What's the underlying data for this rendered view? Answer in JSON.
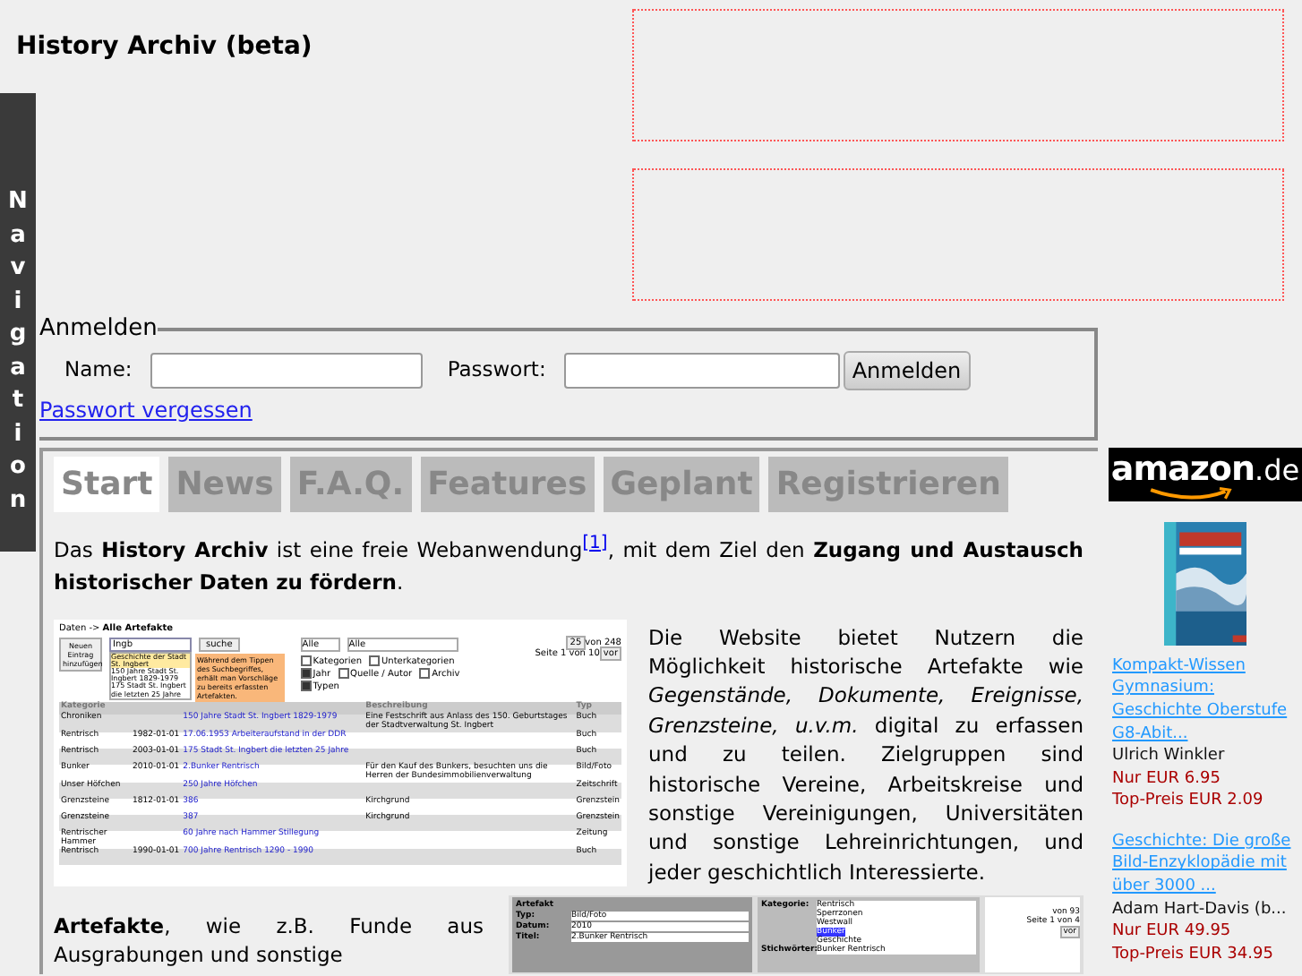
{
  "site_title": "History Archiv (beta)",
  "navigation": {
    "label": "Navigation"
  },
  "login": {
    "legend": "Anmelden",
    "name_label": "Name:",
    "password_label": "Passwort:",
    "submit": "Anmelden",
    "forgot_link": "Passwort vergessen"
  },
  "tabs": [
    {
      "label": "Start",
      "selected": true
    },
    {
      "label": "News",
      "selected": false
    },
    {
      "label": "F.A.Q.",
      "selected": false
    },
    {
      "label": "Features",
      "selected": false
    },
    {
      "label": "Geplant",
      "selected": false
    },
    {
      "label": "Registrieren",
      "selected": false
    }
  ],
  "intro": "Das **History Archiv** ist eine freie Webanwendung$^{[1]}$, mit dem Ziel den **Zugang und Austausch historischer Daten zu fördern**.",
  "description": "Die Website bietet Nutzern die Möglichkeit historische Artefakte wie *Gegenstände, Dokumente, Ereignisse, Grenzsteine, u.v.m.* digital zu erfassen und zu teilen. Zielgruppen sind historische Vereine, Arbeitskreise und sonstige Vereinigungen, Universitäten und sonstige Lehreinrichtungen, und jeder geschichtlich Interessierte.",
  "artefakte": "**Artefakte**, wie z.B. Funde aus Ausgrabungen und sonstige",
  "screenshot_list": {
    "breadcrumb": "Daten -> **Alle Artefakte**",
    "new_button": "Neuen Eintrag hinzufügen",
    "search_value": "Ingb",
    "search_button": "suche",
    "select_1": "Alle",
    "select_2": "Alle",
    "per_page": "25",
    "count": "von 248",
    "page": "Seite 1 von 10",
    "next": "vor",
    "filters": [
      {
        "label": "Kategorien",
        "checked": false
      },
      {
        "label": "Unterkategorien",
        "checked": false
      },
      {
        "label": "Jahr",
        "checked": true
      },
      {
        "label": "Quelle / Autor",
        "checked": false
      },
      {
        "label": "Archiv",
        "checked": false
      },
      {
        "label": "Typen",
        "checked": true
      }
    ],
    "suggestions": [
      {
        "text": "Geschichte der Stadt St. Ingbert",
        "selected": true
      },
      {
        "text": "150 Jahre Stadt St. Ingbert 1829-1979",
        "selected": false
      },
      {
        "text": "175 Stadt St. Ingbert die letzten 25 Jahre",
        "selected": false
      }
    ],
    "tooltip": "Während dem Tippen des Suchbegriffes, erhält man Vorschläge zu bereits erfassten Artefakten.",
    "columns": [
      "Kategorie",
      "Beschreibung",
      "Typ"
    ],
    "rows": [
      {
        "category": "Chroniken",
        "date": "",
        "title": "150 Jahre Stadt St. Ingbert 1829-1979",
        "description": "Eine Festschrift aus Anlass des 150. Geburtstages der Stadtverwaltung St. Ingbert",
        "type": "Buch"
      },
      {
        "category": "Rentrisch",
        "date": "1982-01-01",
        "title": "17.06.1953 Arbeiteraufstand in der DDR",
        "description": "",
        "type": "Buch"
      },
      {
        "category": "Rentrisch",
        "date": "2003-01-01",
        "title": "175 Stadt St. Ingbert die letzten 25 Jahre",
        "description": "",
        "type": "Buch"
      },
      {
        "category": "Bunker",
        "date": "2010-01-01",
        "title": "2.Bunker Rentrisch",
        "description": "Für den Kauf des Bunkers, besuchten uns die Herren der Bundesimmobilienverwaltung",
        "type": "Bild/Foto"
      },
      {
        "category": "Unser Höfchen",
        "date": "",
        "title": "250 Jahre Höfchen",
        "description": "",
        "type": "Zeitschrift"
      },
      {
        "category": "Grenzsteine",
        "date": "1812-01-01",
        "title": "386",
        "description": "Kirchgrund",
        "type": "Grenzstein"
      },
      {
        "category": "Grenzsteine",
        "date": "",
        "title": "387",
        "description": "Kirchgrund",
        "type": "Grenzstein"
      },
      {
        "category": "Rentrischer Hammer",
        "date": "",
        "title": "60 Jahre nach Hammer Stillegung",
        "description": "",
        "type": "Zeitung"
      },
      {
        "category": "Rentrisch",
        "date": "1990-01-01",
        "title": "700 Jahre Rentrisch 1290 - 1990",
        "description": "",
        "type": "Buch"
      }
    ]
  },
  "screenshot_edit": {
    "section": "Artefakt",
    "fields": [
      {
        "label": "Typ:",
        "value": "Bild/Foto"
      },
      {
        "label": "Datum:",
        "value": "2010"
      },
      {
        "label": "Titel:",
        "value": "2.Bunker Rentrisch"
      }
    ],
    "category_label": "Kategorie:",
    "tree": [
      {
        "text": "Rentrisch",
        "selected": false
      },
      {
        "text": "Sperrzonen",
        "selected": false
      },
      {
        "text": "Westwall",
        "selected": false
      },
      {
        "text": "Bunker",
        "selected": true
      },
      {
        "text": "Geschichte",
        "selected": false
      }
    ],
    "keywords_label": "Stichwörter:",
    "keywords": "Bunker Rentrisch",
    "count": "von 93",
    "page": "Seite 1 von 4",
    "next": "vor"
  },
  "amazon": {
    "logo": "amazon",
    "logo_suffix": ".de",
    "items": [
      {
        "title": "Kompakt-Wissen Gymnasium: Geschichte Oberstufe G8-Abit...",
        "author": "Ulrich Winkler",
        "price": "Nur EUR 6.95",
        "top_price": "Top-Preis EUR 2.09"
      },
      {
        "title": "Geschichte: Die große Bild-Enzyklopädie mit über 3000 ...",
        "author": "Adam Hart-Davis (b...",
        "price": "Nur EUR 49.95",
        "top_price": "Top-Preis EUR 34.95"
      }
    ]
  }
}
